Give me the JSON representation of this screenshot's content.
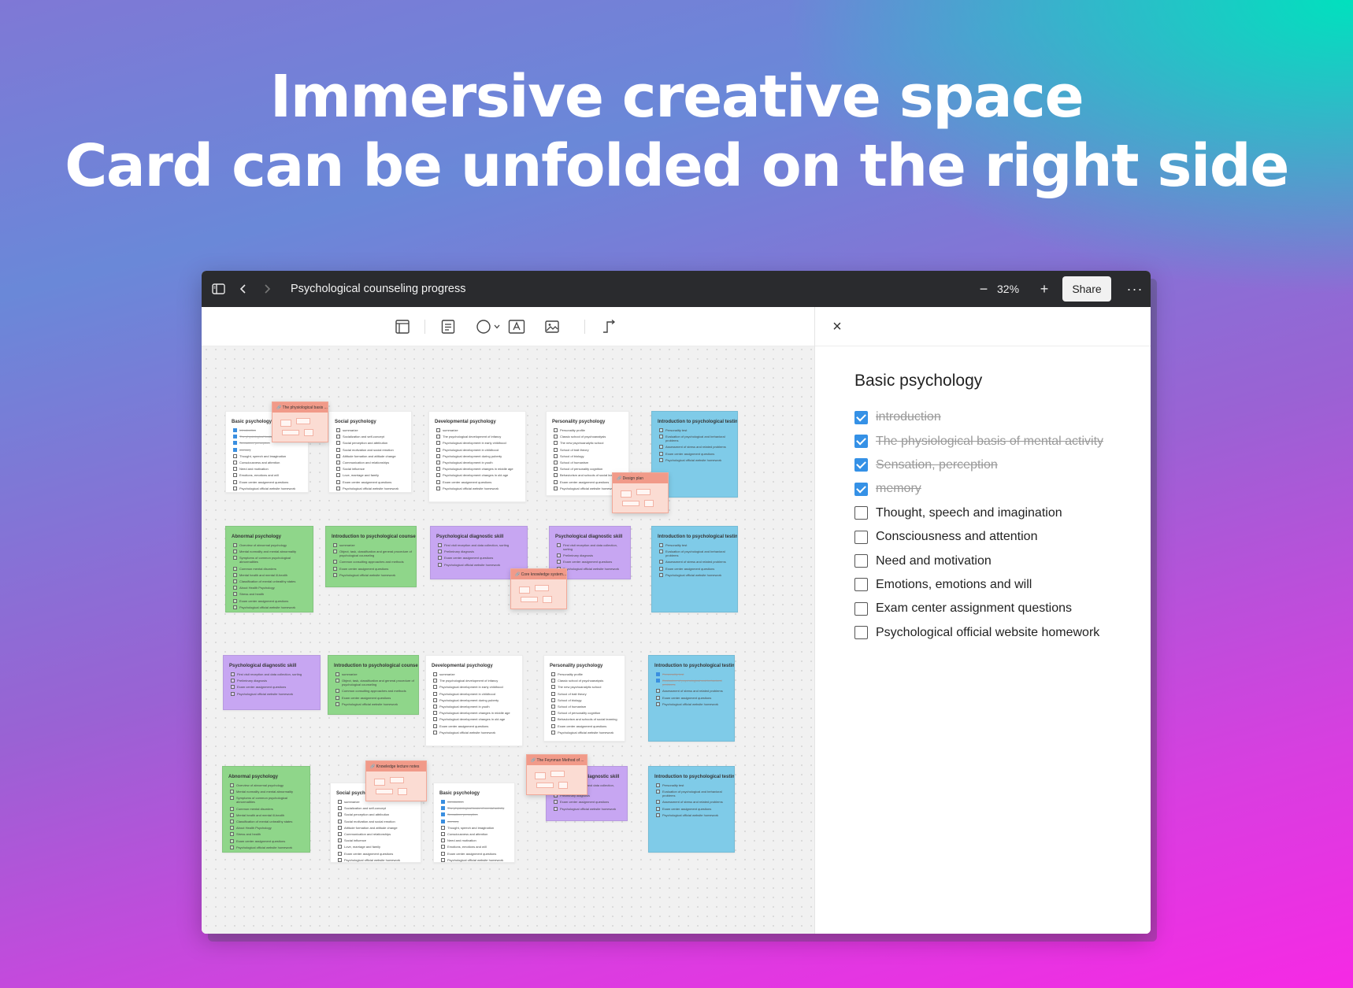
{
  "headline": {
    "line1": "Immersive creative space",
    "line2": "Card can be unfolded on the right side"
  },
  "titlebar": {
    "sidebar_icon": "sidebar-toggle-icon",
    "back_icon": "chevron-left-icon",
    "forward_icon": "chevron-right-icon",
    "doc_title": "Psychological counseling progress",
    "zoom_out": "−",
    "zoom": "32%",
    "zoom_in": "+",
    "share": "Share",
    "more": "···"
  },
  "toolbar": {
    "tools": [
      "frame-icon",
      "text-card-icon",
      "shape-circle-icon",
      "text-box-icon",
      "image-icon",
      "connector-icon"
    ]
  },
  "panel": {
    "close": "×",
    "title": "Basic psychology",
    "items": [
      {
        "label": "introduction",
        "checked": true
      },
      {
        "label": "The physiological basis of mental activity",
        "checked": true
      },
      {
        "label": "Sensation, perception",
        "checked": true
      },
      {
        "label": "memory",
        "checked": true
      },
      {
        "label": "Thought, speech and imagination",
        "checked": false
      },
      {
        "label": "Consciousness and attention",
        "checked": false
      },
      {
        "label": "Need and motivation",
        "checked": false
      },
      {
        "label": "Emotions, emotions and will",
        "checked": false
      },
      {
        "label": "Exam center assignment questions",
        "checked": false
      },
      {
        "label": "Psychological official website homework",
        "checked": false
      }
    ]
  },
  "colors": {
    "white": "#ffffff",
    "green": "#8fd68a",
    "purple": "#c7a6f2",
    "blue": "#7fcbe8",
    "sticky": "#fbdcd3",
    "checked": "#3591e6"
  },
  "canvas": {
    "cards": [
      {
        "title": "Basic psychology",
        "color": "white",
        "items": [
          "Introduction",
          "The physiological basis",
          "Sensation, perception",
          "memory",
          "Thought, speech and imagination",
          "Consciousness and attention",
          "Need and motivation",
          "Emotions, emotions and will",
          "Exam center assignment questions",
          "Psychological official website homework"
        ],
        "done": 4
      },
      {
        "title": "Social psychology",
        "color": "white",
        "items": [
          "summarize",
          "Socialization and self-concept",
          "Social perception and attribution",
          "Social motivation and social emotion",
          "Attitude formation and attitude change",
          "Communication and relationships",
          "Social influence",
          "Love, marriage and family",
          "Exam center assignment questions",
          "Psychological official website homework"
        ],
        "done": 0
      },
      {
        "title": "Developmental psychology",
        "color": "white",
        "items": [
          "summarize",
          "The psychological development of infancy",
          "Psychological development in early childhood",
          "Psychological development in childhood",
          "Psychological development during puberty",
          "Psychological development in youth",
          "Psychological development changes in middle age",
          "Psychological development changes in old age",
          "Exam center assignment questions",
          "Psychological official website homework"
        ],
        "done": 0
      },
      {
        "title": "Personality psychology",
        "color": "white",
        "items": [
          "Personality profile",
          "Classic school of psychoanalysis",
          "The new psychoanalytic school",
          "School of trait theory",
          "School of biology",
          "School of humanism",
          "School of personality cognition",
          "Behaviorism and schools of social learning",
          "Exam center assignment questions",
          "Psychological official website homework"
        ],
        "done": 0
      },
      {
        "title": "Introduction to psychological testing",
        "color": "blue",
        "items": [
          "Personality test",
          "Evaluation of psychological and behavioral problems",
          "Assessment of stress and related problems",
          "Exam center assignment questions",
          "Psychological official website homework"
        ],
        "done": 0
      },
      {
        "title": "Abnormal psychology",
        "color": "green",
        "items": [
          "Overview of abnormal psychology",
          "Mental normality and mental abnormality",
          "Symptoms of common psychological abnormalities",
          "Common mental disorders",
          "Mental health and mental ill-health",
          "Classification of mental unhealthy states",
          "About Health Psychology",
          "Stress and health",
          "Exam center assignment questions",
          "Psychological official website homework"
        ],
        "done": 0
      },
      {
        "title": "Introduction to psychological counseling",
        "color": "green",
        "items": [
          "summarize",
          "Object, task, classification and general procedure of psychological counseling",
          "Common consulting approaches and methods",
          "Exam center assignment questions",
          "Psychological official website homework"
        ],
        "done": 0
      },
      {
        "title": "Psychological diagnostic skill",
        "color": "purple",
        "items": [
          "First visit reception and data collection, sorting",
          "Preliminary diagnosis",
          "Exam center assignment questions",
          "Psychological official website homework"
        ],
        "done": 0
      },
      {
        "title": "Psychological diagnostic skill",
        "color": "purple",
        "items": [
          "First visit reception and data collection, sorting",
          "Preliminary diagnosis",
          "Exam center assignment questions",
          "Psychological official website homework"
        ],
        "done": 0
      },
      {
        "title": "Introduction to psychological testing",
        "color": "blue",
        "items": [
          "Personality test",
          "Evaluation of psychological and behavioral problems",
          "Assessment of stress and related problems",
          "Exam center assignment questions",
          "Psychological official website homework"
        ],
        "done": 0
      },
      {
        "title": "Psychological diagnostic skill",
        "color": "purple",
        "items": [
          "First visit reception and data collection, sorting",
          "Preliminary diagnosis",
          "Exam center assignment questions",
          "Psychological official website homework"
        ],
        "done": 0
      },
      {
        "title": "Introduction to psychological counseling",
        "color": "green",
        "items": [
          "summarize",
          "Object, task, classification and general procedure of psychological counseling",
          "Common consulting approaches and methods",
          "Exam center assignment questions",
          "Psychological official website homework"
        ],
        "done": 0
      },
      {
        "title": "Developmental psychology",
        "color": "white",
        "items": [
          "summarize",
          "The psychological development of infancy",
          "Psychological development in early childhood",
          "Psychological development in childhood",
          "Psychological development during puberty",
          "Psychological development in youth",
          "Psychological development changes in middle age",
          "Psychological development changes in old age",
          "Exam center assignment questions",
          "Psychological official website homework"
        ],
        "done": 0
      },
      {
        "title": "Personality psychology",
        "color": "white",
        "items": [
          "Personality profile",
          "Classic school of psychoanalysis",
          "The new psychoanalytic school",
          "School of trait theory",
          "School of biology",
          "School of humanism",
          "School of personality cognition",
          "Behaviorism and schools of social learning",
          "Exam center assignment questions",
          "Psychological official website homework"
        ],
        "done": 0
      },
      {
        "title": "Introduction to psychological testing",
        "color": "blue",
        "items": [
          "Personality test",
          "Evaluation of psychological and behavioral problems",
          "Assessment of stress and related problems",
          "Exam center assignment questions",
          "Psychological official website homework"
        ],
        "done": 2
      },
      {
        "title": "Abnormal psychology",
        "color": "green",
        "items": [
          "Overview of abnormal psychology",
          "Mental normality and mental abnormality",
          "Symptoms of common psychological abnormalities",
          "Common mental disorders",
          "Mental health and mental ill-health",
          "Classification of mental unhealthy states",
          "About Health Psychology",
          "Stress and health",
          "Exam center assignment questions",
          "Psychological official website homework"
        ],
        "done": 0
      },
      {
        "title": "Social psychology",
        "color": "white",
        "items": [
          "summarize",
          "Socialization and self-concept",
          "Social perception and attribution",
          "Social motivation and social emotion",
          "Attitude formation and attitude change",
          "Communication and relationships",
          "Social influence",
          "Love, marriage and family",
          "Exam center assignment questions",
          "Psychological official website homework"
        ],
        "done": 0
      },
      {
        "title": "Basic psychology",
        "color": "white",
        "items": [
          "introduction",
          "The physiological basis of mental activity",
          "Sensation, perception",
          "memory",
          "Thought, speech and imagination",
          "Consciousness and attention",
          "Need and motivation",
          "Emotions, emotions and will",
          "Exam center assignment questions",
          "Psychological official website homework"
        ],
        "done": 4
      },
      {
        "title": "Psychological diagnostic skill",
        "color": "purple",
        "items": [
          "First visit reception and data collection, sorting",
          "Preliminary diagnosis",
          "Exam center assignment questions",
          "Psychological official website homework"
        ],
        "done": 0
      },
      {
        "title": "Introduction to psychological testing",
        "color": "blue",
        "items": [
          "Personality test",
          "Evaluation of psychological and behavioral problems",
          "Assessment of stress and related problems",
          "Exam center assignment questions",
          "Psychological official website homework"
        ],
        "done": 0
      }
    ],
    "stickies": [
      {
        "title": "The physiological basis ..."
      },
      {
        "title": "Design plan"
      },
      {
        "title": "Core knowledge system..."
      },
      {
        "title": "Knowledge lecture notes"
      },
      {
        "title": "The Feynman Method of ..."
      }
    ]
  }
}
